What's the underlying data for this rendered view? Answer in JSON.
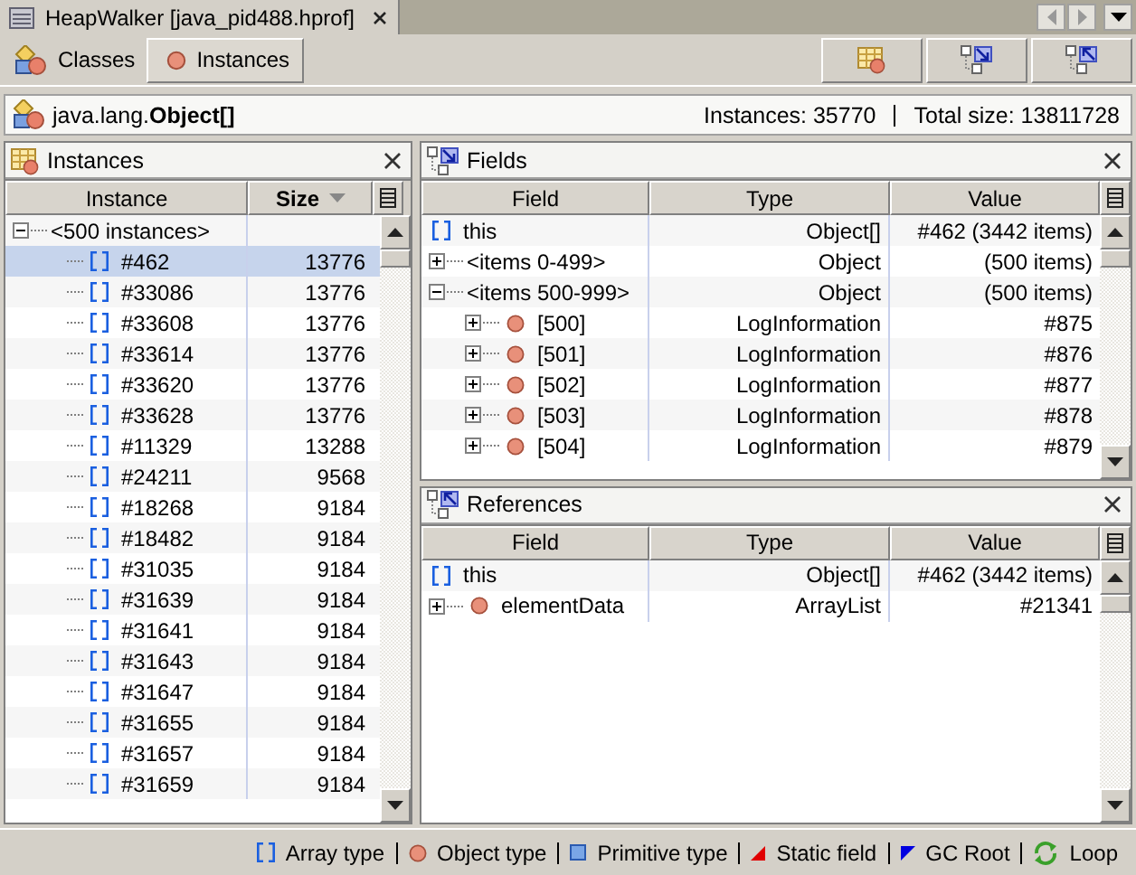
{
  "editor_tab": {
    "title": "HeapWalker [java_pid488.hprof]"
  },
  "view_tabs": [
    {
      "label": "Classes",
      "kind": "classes",
      "selected": false
    },
    {
      "label": "Instances",
      "kind": "instances",
      "selected": true
    }
  ],
  "toolbar_buttons": [
    {
      "kind": "table"
    },
    {
      "kind": "fields"
    },
    {
      "kind": "references"
    }
  ],
  "class_header": {
    "name": "java.lang.**Object[]**",
    "instances": "Instances: 35770",
    "total_size": "Total size: 13811728"
  },
  "instances_panel": {
    "title": "Instances",
    "columns": [
      {
        "label": "Instance",
        "sorted": false
      },
      {
        "label": "Size",
        "sorted": true
      }
    ],
    "rows": [
      {
        "label": "<500 instances>",
        "kind": "group",
        "expanded": true,
        "selected": false,
        "children": [
          {
            "label": "#462",
            "size": "13776",
            "kind": "array",
            "selected": true
          },
          {
            "label": "#33086",
            "size": "13776",
            "kind": "array",
            "selected": false
          },
          {
            "label": "#33608",
            "size": "13776",
            "kind": "array",
            "selected": false
          },
          {
            "label": "#33614",
            "size": "13776",
            "kind": "array",
            "selected": false
          },
          {
            "label": "#33620",
            "size": "13776",
            "kind": "array",
            "selected": false
          },
          {
            "label": "#33628",
            "size": "13776",
            "kind": "array",
            "selected": false
          },
          {
            "label": "#11329",
            "size": "13288",
            "kind": "array",
            "selected": false
          },
          {
            "label": "#24211",
            "size": "9568",
            "kind": "array",
            "selected": false
          },
          {
            "label": "#18268",
            "size": "9184",
            "kind": "array",
            "selected": false
          },
          {
            "label": "#18482",
            "size": "9184",
            "kind": "array",
            "selected": false
          },
          {
            "label": "#31035",
            "size": "9184",
            "kind": "array",
            "selected": false
          },
          {
            "label": "#31639",
            "size": "9184",
            "kind": "array",
            "selected": false
          },
          {
            "label": "#31641",
            "size": "9184",
            "kind": "array",
            "selected": false
          },
          {
            "label": "#31643",
            "size": "9184",
            "kind": "array",
            "selected": false
          },
          {
            "label": "#31647",
            "size": "9184",
            "kind": "array",
            "selected": false
          },
          {
            "label": "#31655",
            "size": "9184",
            "kind": "array",
            "selected": false
          },
          {
            "label": "#31657",
            "size": "9184",
            "kind": "array",
            "selected": false
          },
          {
            "label": "#31659",
            "size": "9184",
            "kind": "array",
            "selected": false
          }
        ]
      }
    ]
  },
  "fields_panel": {
    "title": "Fields",
    "columns": [
      {
        "label": "Field"
      },
      {
        "label": "Type"
      },
      {
        "label": "Value"
      }
    ],
    "rows": [
      {
        "label": "this",
        "kind": "array",
        "type": "Object[]",
        "value": "#462 (3442 items)"
      },
      {
        "label": "<items 0-499>",
        "kind": "group",
        "expanded": false,
        "type": "Object",
        "value": "(500 items)"
      },
      {
        "label": "<items 500-999>",
        "kind": "group",
        "expanded": true,
        "type": "Object",
        "value": "(500 items)",
        "children": [
          {
            "label": "[500]",
            "kind": "object",
            "expanded": false,
            "type": "LogInformation",
            "value": "#875"
          },
          {
            "label": "[501]",
            "kind": "object",
            "expanded": false,
            "type": "LogInformation",
            "value": "#876"
          },
          {
            "label": "[502]",
            "kind": "object",
            "expanded": false,
            "type": "LogInformation",
            "value": "#877"
          },
          {
            "label": "[503]",
            "kind": "object",
            "expanded": false,
            "type": "LogInformation",
            "value": "#878"
          },
          {
            "label": "[504]",
            "kind": "object",
            "expanded": false,
            "type": "LogInformation",
            "value": "#879"
          }
        ]
      }
    ]
  },
  "references_panel": {
    "title": "References",
    "columns": [
      {
        "label": "Field"
      },
      {
        "label": "Type"
      },
      {
        "label": "Value"
      }
    ],
    "rows": [
      {
        "label": "this",
        "kind": "array",
        "type": "Object[]",
        "value": "#462 (3442 items)"
      },
      {
        "label": "elementData",
        "kind": "object",
        "expanded": false,
        "type": "ArrayList",
        "value": "#21341"
      }
    ]
  },
  "legend": [
    {
      "kind": "array",
      "label": "Array type"
    },
    {
      "kind": "object",
      "label": "Object type"
    },
    {
      "kind": "primitive",
      "label": "Primitive type"
    },
    {
      "kind": "static",
      "label": "Static field"
    },
    {
      "kind": "gcroot",
      "label": "GC Root"
    },
    {
      "kind": "loop",
      "label": "Loop"
    }
  ]
}
